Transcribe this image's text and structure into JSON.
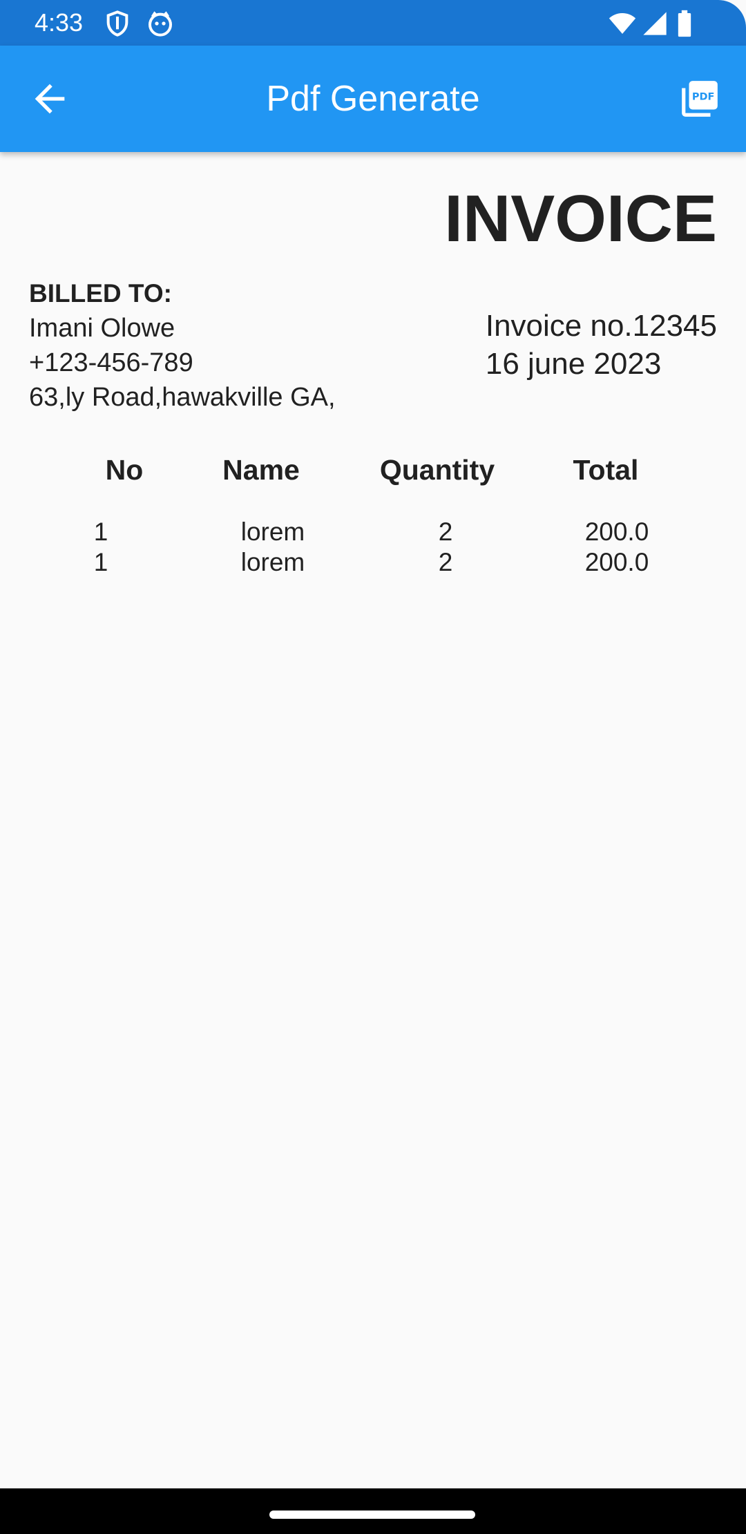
{
  "status_bar": {
    "time": "4:33",
    "background": "#1976d2",
    "icons": [
      "shield-icon",
      "cat-face-icon",
      "wifi-icon",
      "cellular-signal-icon",
      "battery-icon"
    ]
  },
  "app_bar": {
    "title": "Pdf Generate",
    "background": "#2196f3",
    "back_icon": "arrow-back-icon",
    "action_icon": "picture-as-pdf-icon"
  },
  "invoice": {
    "heading": "INVOICE",
    "billed_to_label": "BILLED TO:",
    "customer_name": "Imani Olowe",
    "customer_phone": "+123-456-789",
    "customer_address": "63,ly Road,hawakville GA,",
    "invoice_number": "Invoice no.12345",
    "date": "16 june 2023"
  },
  "table": {
    "headers": [
      "No",
      "Name",
      "Quantity",
      "Total"
    ],
    "rows": [
      [
        "1",
        "lorem",
        "2",
        "200.0"
      ],
      [
        "1",
        "lorem",
        "2",
        "200.0"
      ]
    ]
  },
  "nav_bar": {
    "handle": "gesture-handle"
  }
}
